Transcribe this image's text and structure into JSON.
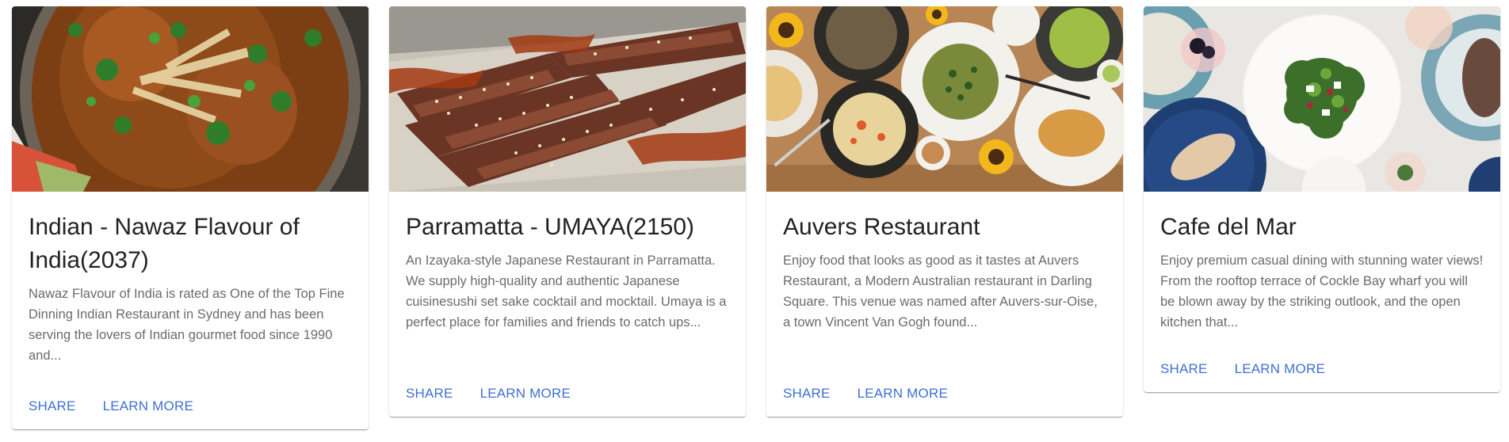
{
  "cards": [
    {
      "image_alt": "Indian curry dish with herbs and grated cheese",
      "title": "Indian - Nawaz Flavour of India(2037)",
      "description": "Nawaz Flavour of India is rated as One of the Top Fine Dinning Indian Restaurant in Sydney and has been serving the lovers of Indian gourmet food since 1990 and...",
      "share_label": "SHARE",
      "learn_more_label": "LEARN MORE"
    },
    {
      "image_alt": "Grilled sliced beef with sesame and sauce",
      "title": "Parramatta - UMAYA(2150)",
      "description": "An Izayaka-style Japanese Restaurant in Parramatta. We supply high-quality and authentic Japanese cuisinesushi set sake cocktail and mocktail. Umaya is a perfect place for families and friends to catch ups...",
      "share_label": "SHARE",
      "learn_more_label": "LEARN MORE"
    },
    {
      "image_alt": "Table spread of brunch dishes with sunflowers",
      "title": "Auvers Restaurant",
      "description": "Enjoy food that looks as good as it tastes at Auvers Restaurant, a Modern Australian restaurant in Darling Square. This venue was named after Auvers-sur-Oise, a town Vincent Van Gogh found...",
      "share_label": "SHARE",
      "learn_more_label": "LEARN MORE"
    },
    {
      "image_alt": "Salad plate with drinks on a light table",
      "title": "Cafe del Mar",
      "description": "Enjoy premium casual dining with stunning water views! From the rooftop terrace of Cockle Bay wharf you will be blown away by the striking outlook, and the open kitchen that...",
      "share_label": "SHARE",
      "learn_more_label": "LEARN MORE"
    }
  ],
  "colors": {
    "accent": "#3f6fd1",
    "title": "#222222",
    "body_text": "#6b6b6b"
  }
}
